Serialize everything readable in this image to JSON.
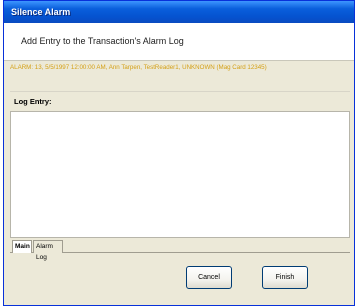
{
  "window": {
    "title": "Silence Alarm"
  },
  "header": {
    "text": "Add Entry to the Transaction's Alarm Log"
  },
  "alarm_info": "ALARM: 13, 5/5/1997 12:00:00 AM, Ann Tarpen, TestReader1, UNKNOWN (Mag Card 12345)",
  "log_entry": {
    "label": "Log Entry:",
    "value": ""
  },
  "tabs": [
    {
      "label": "Main",
      "active": true
    },
    {
      "label": "Alarm Log",
      "active": false
    }
  ],
  "buttons": {
    "cancel": "Cancel",
    "finish": "Finish"
  }
}
